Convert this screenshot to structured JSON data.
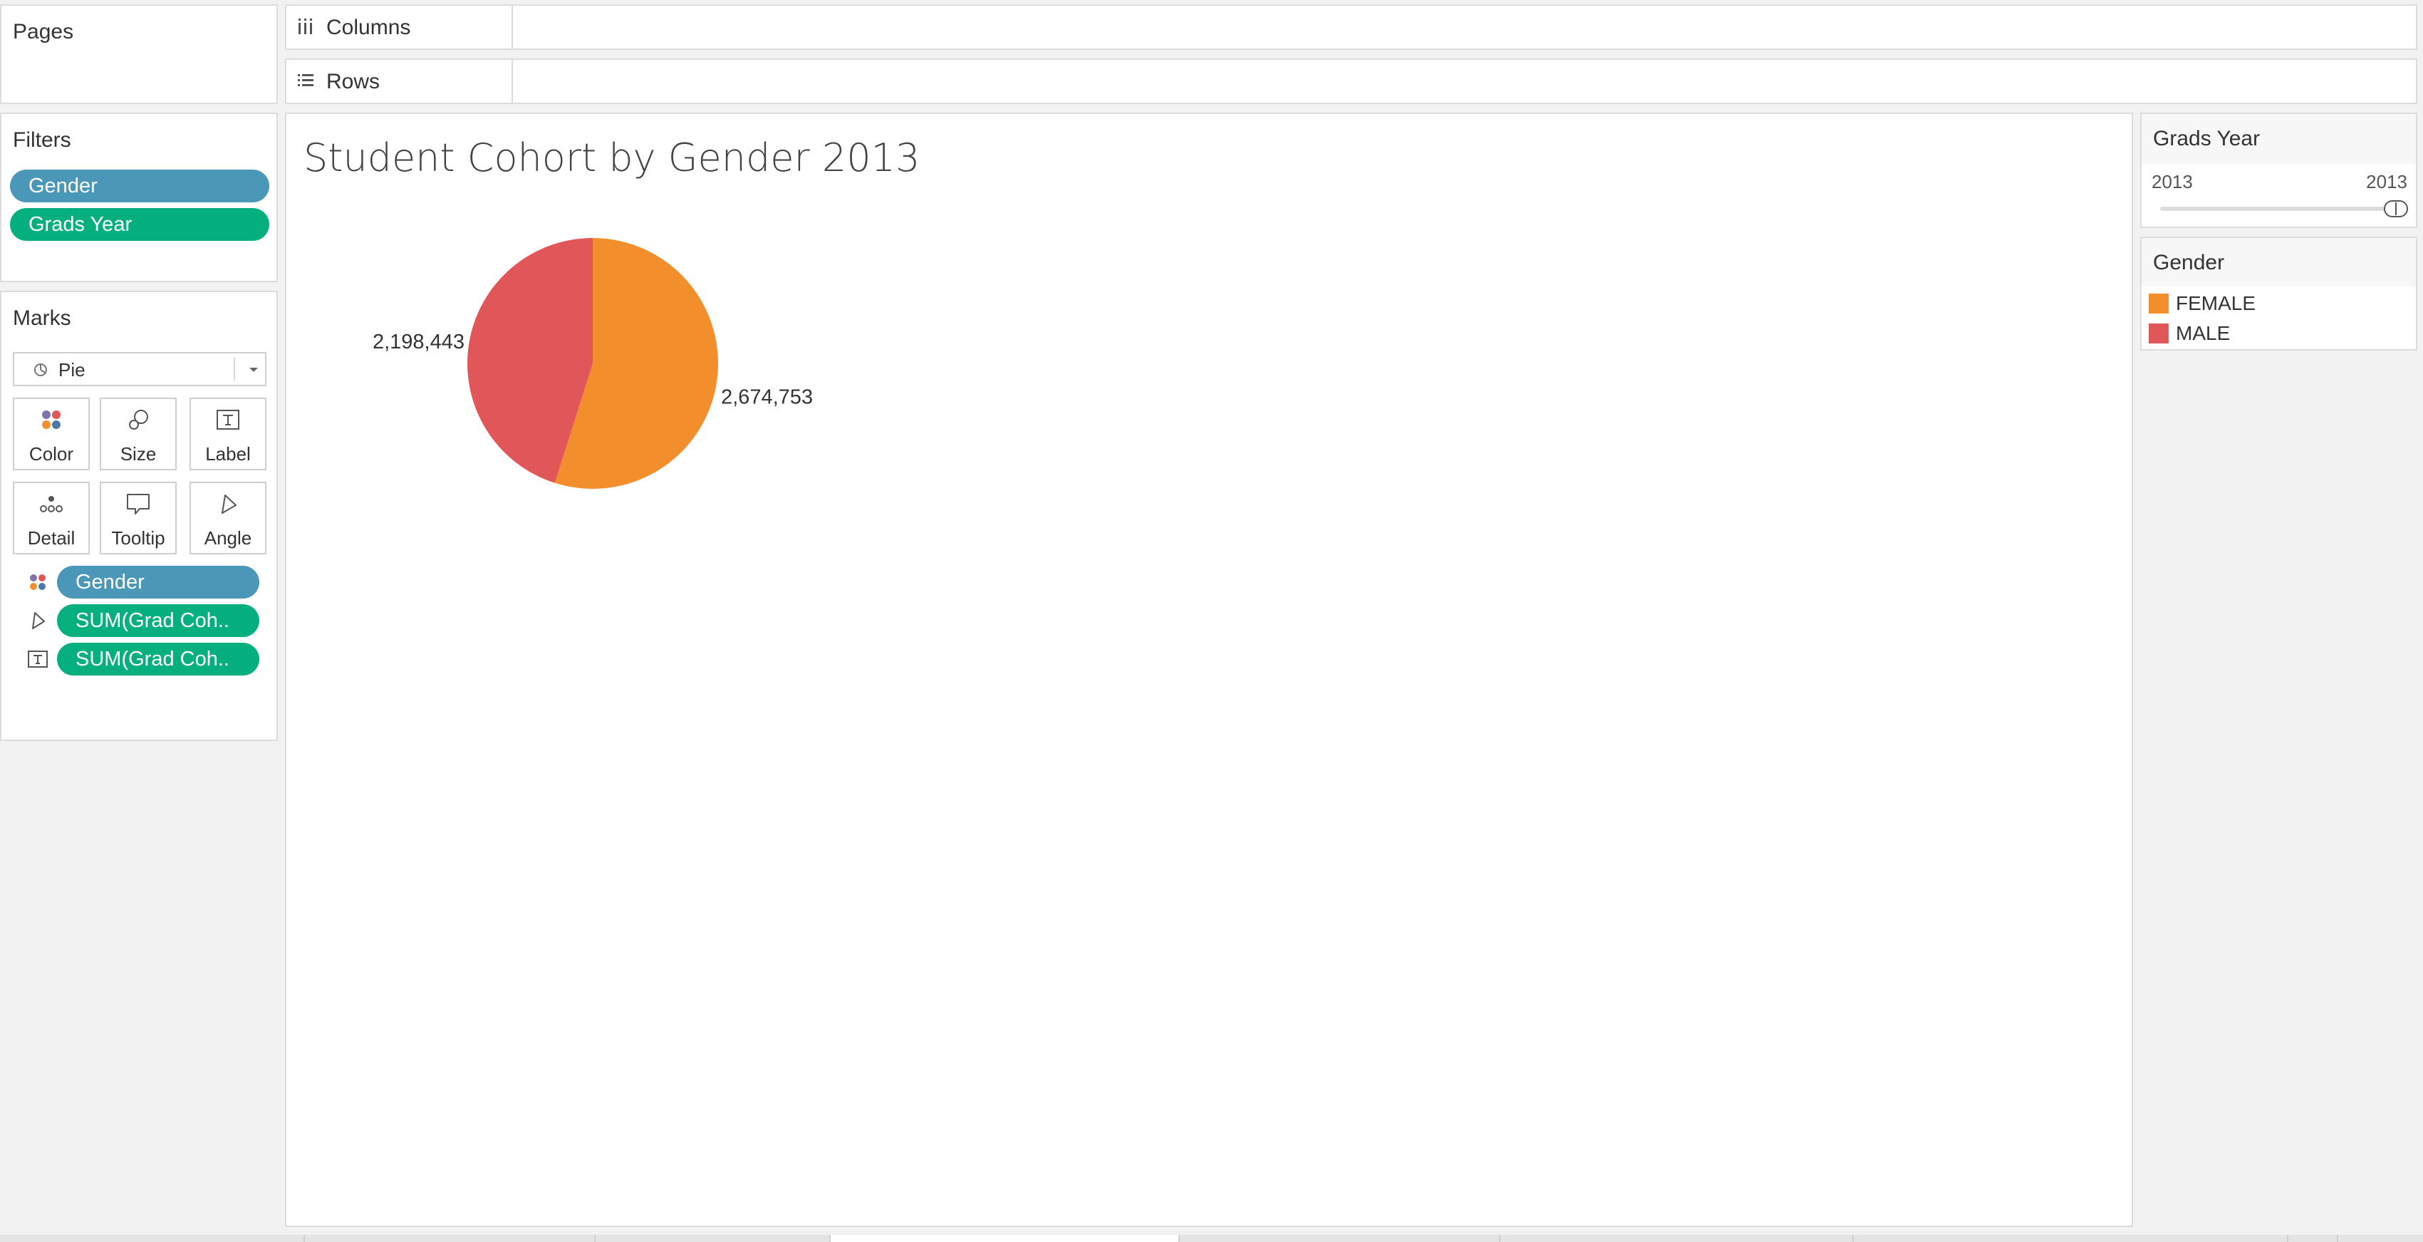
{
  "pages_panel": {
    "title": "Pages"
  },
  "shelves": {
    "columns": "Columns",
    "rows": "Rows"
  },
  "filters_panel": {
    "title": "Filters",
    "pills": [
      {
        "label": "Gender",
        "color": "#4a97b7"
      },
      {
        "label": "Grads Year",
        "color": "#06b07e"
      }
    ]
  },
  "marks_panel": {
    "title": "Marks",
    "mark_type": "Pie",
    "cards": [
      {
        "label": "Color",
        "icon": "color-icon"
      },
      {
        "label": "Size",
        "icon": "size-icon"
      },
      {
        "label": "Label",
        "icon": "label-icon"
      },
      {
        "label": "Detail",
        "icon": "detail-icon"
      },
      {
        "label": "Tooltip",
        "icon": "tooltip-icon"
      },
      {
        "label": "Angle",
        "icon": "angle-icon"
      }
    ],
    "fields": [
      {
        "label": "Gender",
        "icon": "color-icon",
        "color": "#4a97b7"
      },
      {
        "label": "SUM(Grad Coh..",
        "icon": "angle-icon",
        "color": "#06b07e"
      },
      {
        "label": "SUM(Grad Coh..",
        "icon": "label-icon",
        "color": "#06b07e"
      }
    ]
  },
  "chart_data": {
    "type": "pie",
    "title": "Student Cohort by Gender 2013",
    "categories": [
      "FEMALE",
      "MALE"
    ],
    "values": [
      2674753,
      2198443
    ],
    "labels": [
      "2,674,753",
      "2,198,443"
    ],
    "colors": [
      "#f28e2b",
      "#e15759"
    ]
  },
  "grads_year_filter": {
    "title": "Grads Year",
    "min_label": "2013",
    "max_label": "2013",
    "value": 2013
  },
  "gender_legend": {
    "title": "Gender",
    "items": [
      {
        "label": "FEMALE",
        "color": "#f28e2b"
      },
      {
        "label": "MALE",
        "color": "#e15759"
      }
    ]
  }
}
